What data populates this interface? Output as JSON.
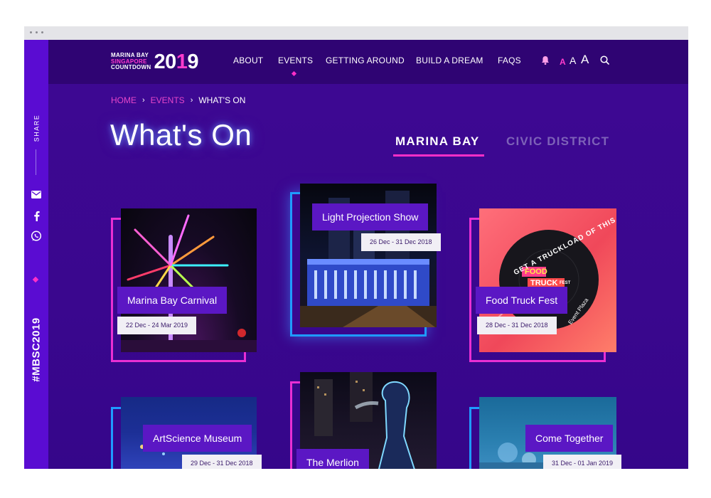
{
  "nav": {
    "logo": {
      "line1": "MARINA BAY",
      "line2": "SINGAPORE",
      "line3": "COUNTDOWN",
      "year_a": "20",
      "year_b": "1",
      "year_c": "9"
    },
    "items": [
      "ABOUT",
      "EVENTS",
      "GETTING AROUND",
      "BUILD A DREAM",
      "FAQS"
    ],
    "active": "EVENTS",
    "font_sizes": [
      "A",
      "A",
      "A"
    ]
  },
  "siderail": {
    "share_label": "SHARE",
    "hashtag": "#MBSC2019"
  },
  "breadcrumb": {
    "home": "HOME",
    "events": "EVENTS",
    "current": "WHAT'S ON"
  },
  "page": {
    "title": "What's On",
    "tabs": [
      {
        "label": "MARINA BAY",
        "active": true
      },
      {
        "label": "CIVIC DISTRICT",
        "active": false
      }
    ]
  },
  "cards": [
    {
      "title": "Marina Bay Carnival",
      "date": "22 Dec - 24 Mar 2019",
      "frame_color": "#e92fd3"
    },
    {
      "title": "Light Projection Show",
      "date": "26 Dec - 31 Dec 2018",
      "frame_color": "#1f9bff"
    },
    {
      "title": "Food Truck Fest",
      "date": "28 Dec - 31 Dec 2018",
      "frame_color": "#e92fd3",
      "badge": {
        "ring_text": "GET A TRUCKLOAD OF THIS",
        "brand_1": "FOOD",
        "brand_2": "TRUCK",
        "brand_3": "FEST",
        "sub": "Event Plaza"
      }
    },
    {
      "title": "ArtScience Museum",
      "date": "29 Dec - 31 Dec 2018",
      "frame_color": "#1f9bff"
    },
    {
      "title": "The Merlion",
      "frame_color": "#e92fd3"
    },
    {
      "title": "Come Together",
      "date": "31 Dec - 01 Jan 2019",
      "frame_color": "#1f9bff"
    }
  ],
  "colors": {
    "accent": "#ff2fc8",
    "nav_bg": "#2f0473",
    "page_bg": "#3e0893",
    "rail_bg": "#5a0cd2",
    "card_label_bg": "#5b17c4"
  }
}
